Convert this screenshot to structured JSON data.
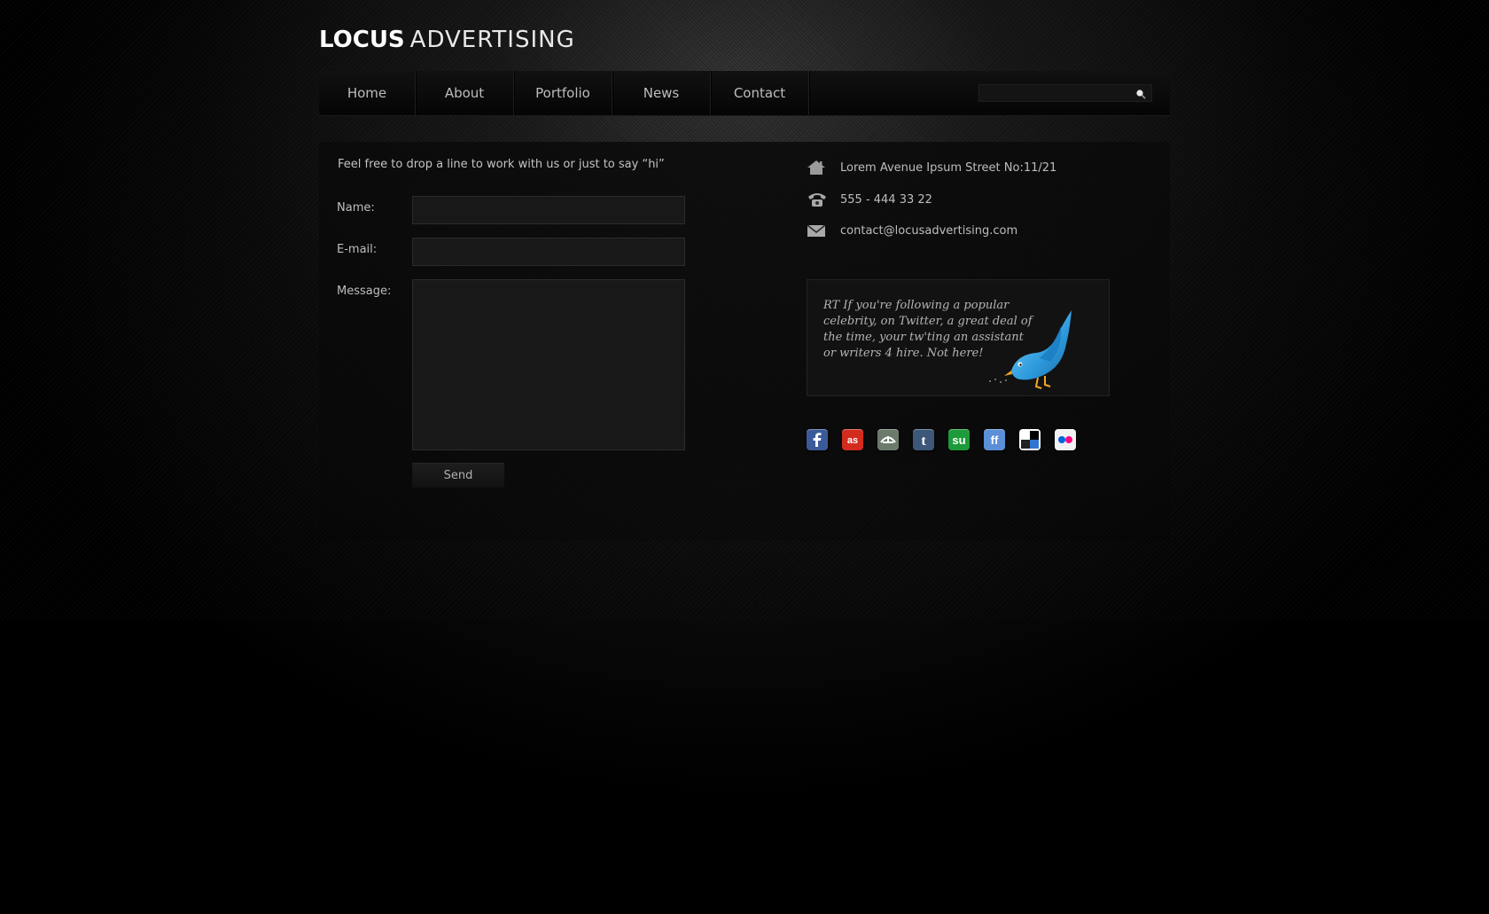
{
  "logo": {
    "bold": "LOCUS",
    "light": "ADVERTISING"
  },
  "nav": {
    "items": [
      {
        "label": "Home"
      },
      {
        "label": "About"
      },
      {
        "label": "Portfolio"
      },
      {
        "label": "News"
      },
      {
        "label": "Contact"
      }
    ],
    "search_value": "",
    "search_icon": "search-icon"
  },
  "form": {
    "intro": "Feel free to drop a line to work with us or just to say “hi”",
    "name_label": "Name:",
    "name_value": "",
    "email_label": "E-mail:",
    "email_value": "",
    "message_label": "Message:",
    "message_value": "",
    "send_label": "Send"
  },
  "contact": {
    "address": "Lorem Avenue Ipsum Street No:11/21",
    "address_icon": "home-icon",
    "phone": "555 - 444 33 22",
    "phone_icon": "phone-icon",
    "email": "contact@locusadvertising.com",
    "email_icon": "mail-icon"
  },
  "tweet": {
    "text": "RT If you're following a popular celebrity, on Twitter, a great deal of the time, your tw'ting an assistant or writers 4 hire. Not here!",
    "icon": "twitter-bird-icon"
  },
  "social": [
    {
      "icon": "facebook-icon",
      "color": "#3b5a9a"
    },
    {
      "icon": "lastfm-icon",
      "color": "#d42b1f"
    },
    {
      "icon": "digg-icon",
      "color": "#6b7a6b"
    },
    {
      "icon": "tumblr-icon",
      "color": "#3d5778"
    },
    {
      "icon": "stumbleupon-icon",
      "color": "#1d9b3a"
    },
    {
      "icon": "friendfeed-icon",
      "color": "#5b8fd8"
    },
    {
      "icon": "delicious-icon",
      "color": "#ffffff"
    },
    {
      "icon": "flickr-icon",
      "color": "#f2f2f2"
    }
  ],
  "colors": {
    "background": "#000000",
    "nav_text": "#bdbdbd",
    "body_text": "#c3c3c3",
    "twitter_blue": "#2e9bdd"
  }
}
